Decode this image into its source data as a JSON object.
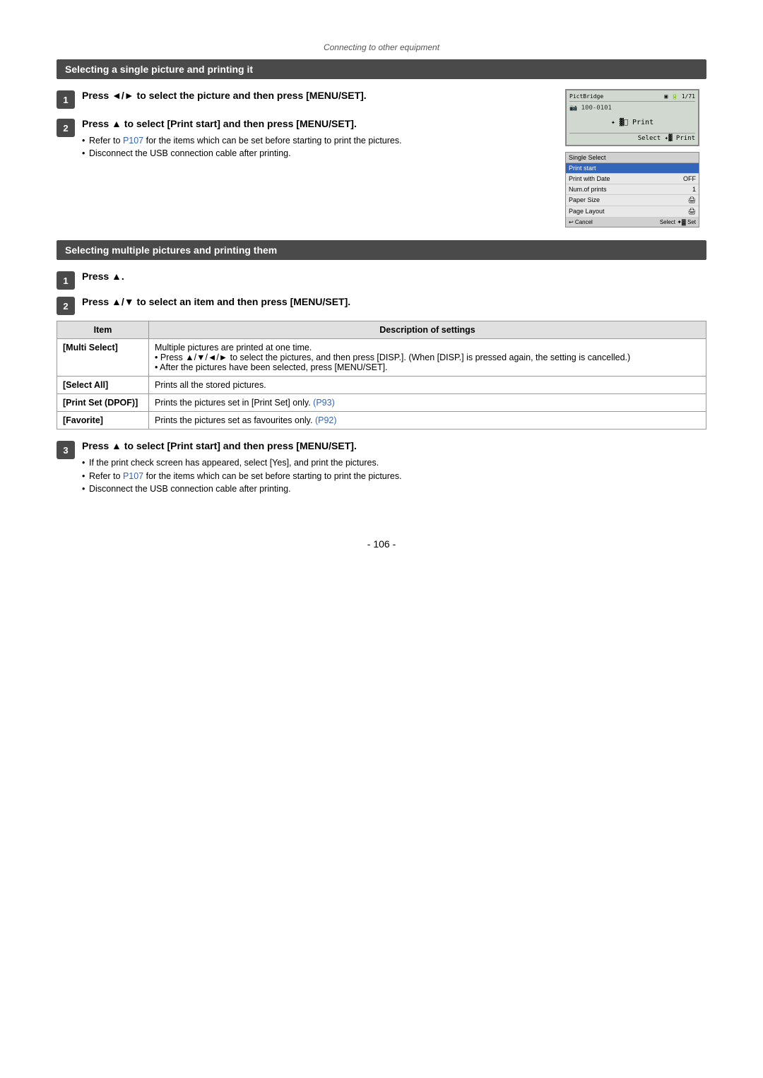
{
  "page": {
    "header": "Connecting to other equipment",
    "page_number": "- 106 -"
  },
  "section1": {
    "title": "Selecting a single picture and printing it",
    "step1": {
      "number": "1",
      "text": "Press ◄/► to select the picture and then press [MENU/SET]."
    },
    "step2": {
      "number": "2",
      "text": "Press ▲ to select [Print start] and then press [MENU/SET].",
      "bullets": [
        "Refer to P107 for the items which can be set before starting to print the pictures.",
        "Disconnect the USB connection cable after printing."
      ]
    }
  },
  "section2": {
    "title": "Selecting multiple pictures and printing them",
    "step1": {
      "number": "1",
      "text": "Press ▲."
    },
    "step2": {
      "number": "2",
      "text": "Press ▲/▼ to select an item and then press [MENU/SET]."
    },
    "table": {
      "col1": "Item",
      "col2": "Description of settings",
      "rows": [
        {
          "item": "[Multi Select]",
          "description": "Multiple pictures are printed at one time.\n• Press ▲/▼/◄/► to select the pictures, and then press [DISP.]. (When [DISP.] is pressed again, the setting is cancelled.)\n• After the pictures have been selected, press [MENU/SET]."
        },
        {
          "item": "[Select All]",
          "description": "Prints all the stored pictures."
        },
        {
          "item": "[Print Set (DPOF)]",
          "description": "Prints the pictures set in [Print Set] only. (P93)"
        },
        {
          "item": "[Favorite]",
          "description": "Prints the pictures set as favourites only. (P92)"
        }
      ]
    },
    "step3": {
      "number": "3",
      "text": "Press ▲ to select [Print start] and then press [MENU/SET].",
      "bullets": [
        "If the print check screen has appeared, select [Yes], and print the pictures.",
        "Refer to P107 for the items which can be set before starting to print the pictures.",
        "Disconnect the USB connection cable after printing."
      ]
    }
  },
  "lcd": {
    "top_left": "PictBridge",
    "top_right1": "▣",
    "top_right2": "🔋",
    "counter": "1/71",
    "folder": "100-0101",
    "center_icon": "✦ ▓⃞ Print",
    "footer": "Select ✦▓ Print"
  },
  "menu": {
    "header": "Single Select",
    "rows": [
      {
        "label": "Print start",
        "value": "",
        "highlighted": true
      },
      {
        "label": "Print with Date",
        "value": "OFF"
      },
      {
        "label": "Num.of prints",
        "value": "1"
      },
      {
        "label": "Paper Size",
        "value": "🖨"
      },
      {
        "label": "Page Layout",
        "value": "🖨"
      }
    ],
    "footer_left": "↩ Cancel",
    "footer_right": "Select ✦▓ Set"
  }
}
